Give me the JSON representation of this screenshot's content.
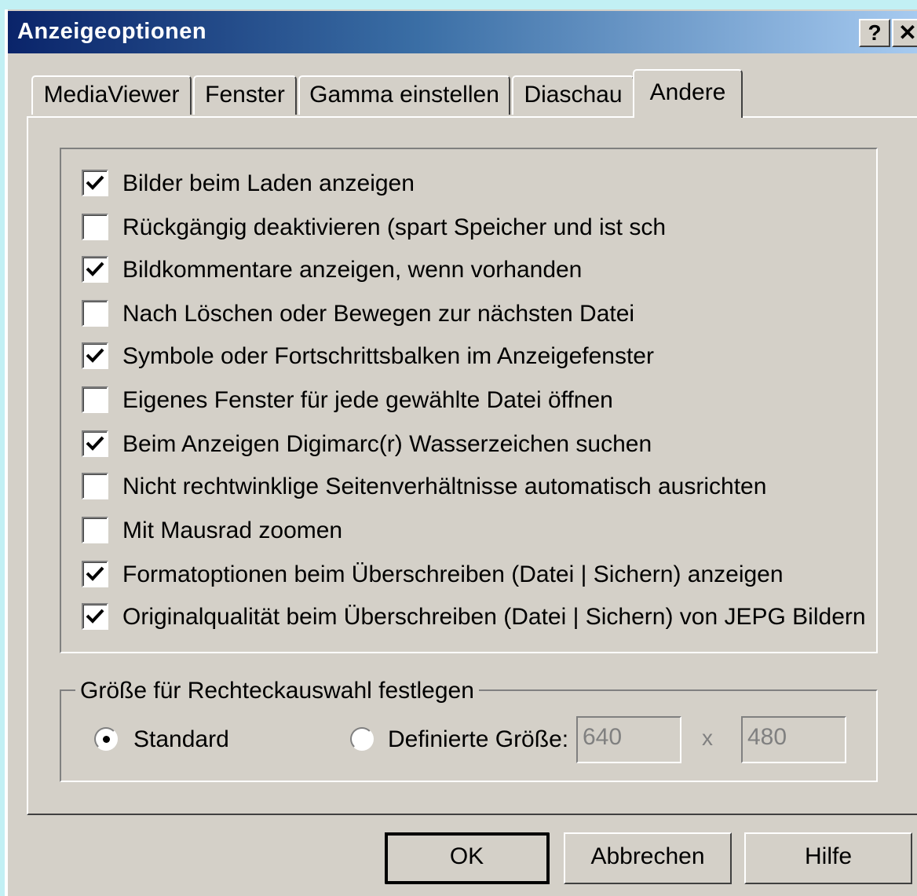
{
  "window": {
    "title": "Anzeigeoptionen",
    "help_button": "?",
    "close_button": "✕"
  },
  "tabs": [
    {
      "label": "MediaViewer",
      "active": false
    },
    {
      "label": "Fenster",
      "active": false
    },
    {
      "label": "Gamma einstellen",
      "active": false
    },
    {
      "label": "Diaschau",
      "active": false
    },
    {
      "label": "Andere",
      "active": true
    }
  ],
  "options": [
    {
      "label": "Bilder beim Laden anzeigen",
      "checked": true
    },
    {
      "label": "Rückgängig deaktivieren (spart Speicher und ist sch",
      "checked": false
    },
    {
      "label": "Bildkommentare anzeigen, wenn vorhanden",
      "checked": true
    },
    {
      "label": "Nach Löschen oder Bewegen zur nächsten Datei",
      "checked": false
    },
    {
      "label": "Symbole oder Fortschrittsbalken im Anzeigefenster",
      "checked": true
    },
    {
      "label": "Eigenes Fenster für jede gewählte Datei öffnen",
      "checked": false
    },
    {
      "label": "Beim Anzeigen Digimarc(r) Wasserzeichen suchen",
      "checked": true
    },
    {
      "label": "Nicht rechtwinklige Seitenverhältnisse automatisch ausrichten",
      "checked": false
    },
    {
      "label": "Mit Mausrad zoomen",
      "checked": false
    },
    {
      "label": "Formatoptionen beim Überschreiben (Datei | Sichern) anzeigen",
      "checked": true
    },
    {
      "label": "Originalqualität beim Überschreiben (Datei | Sichern) von JEPG Bildern",
      "checked": true
    }
  ],
  "selection_size": {
    "group_title": "Größe für Rechteckauswahl festlegen",
    "radio_standard": "Standard",
    "radio_defined": "Definierte Größe:",
    "selected": "Standard",
    "width_value": "640",
    "separator": "x",
    "height_value": "480"
  },
  "buttons": {
    "ok": "OK",
    "cancel": "Abbrechen",
    "help": "Hilfe"
  }
}
